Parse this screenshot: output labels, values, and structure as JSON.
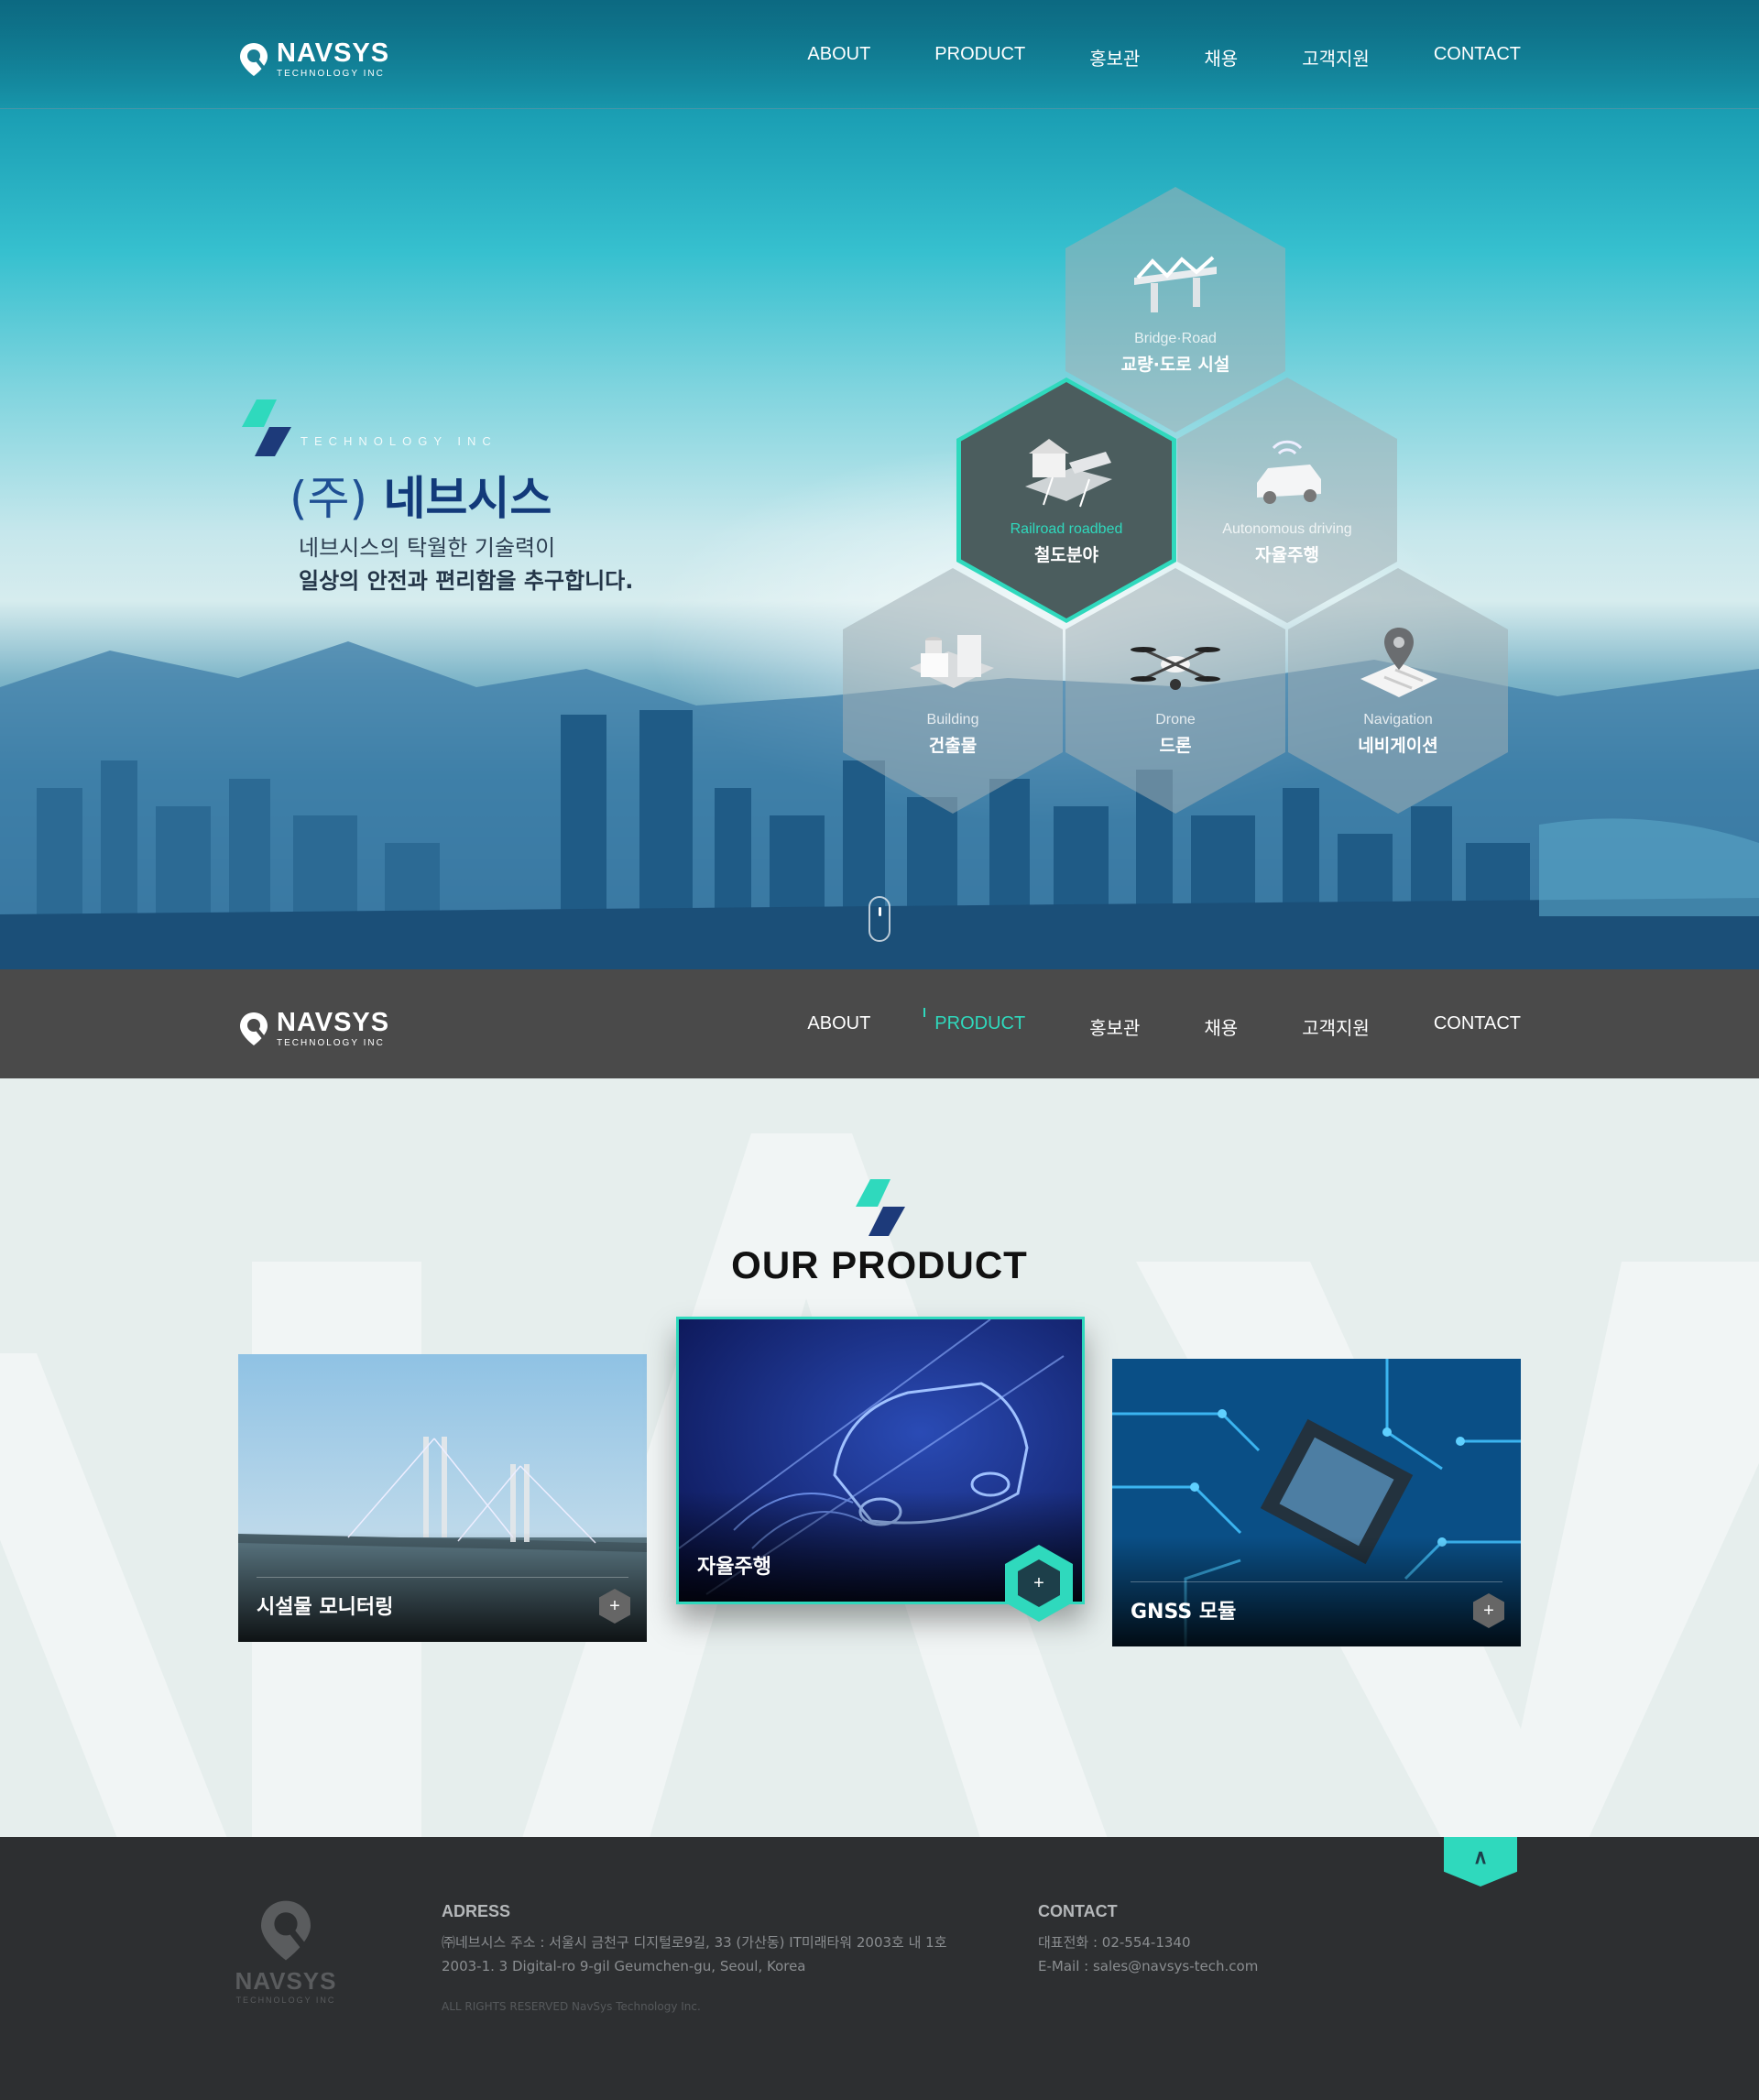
{
  "brand": {
    "name": "NAVSYS",
    "sub": "TECHNOLOGY INC"
  },
  "nav": {
    "items": [
      {
        "label": "ABOUT"
      },
      {
        "label": "PRODUCT"
      },
      {
        "label": "홍보관"
      },
      {
        "label": "채용"
      },
      {
        "label": "고객지원"
      },
      {
        "label": "CONTACT"
      }
    ],
    "active_secondary": "PRODUCT"
  },
  "hero": {
    "tech": "TECHNOLOGY INC",
    "company_paren": "(주)",
    "company_name": "네브시스",
    "line1": "네브시스의 탁월한 기술력이",
    "line2": "일상의 안전과 편리함을 추구합니다.",
    "hexes": [
      {
        "en": "Bridge·Road",
        "ko": "교량·도로 시설",
        "icon": "bridge-icon"
      },
      {
        "en": "Railroad roadbed",
        "ko": "철도분야",
        "icon": "railroad-icon",
        "active": true
      },
      {
        "en": "Autonomous driving",
        "ko": "자율주행",
        "icon": "car-icon"
      },
      {
        "en": "Building",
        "ko": "건출물",
        "icon": "building-icon"
      },
      {
        "en": "Drone",
        "ko": "드론",
        "icon": "drone-icon"
      },
      {
        "en": "Navigation",
        "ko": "네비게이션",
        "icon": "navigation-pin-icon"
      }
    ]
  },
  "products": {
    "heading": "OUR PRODUCT",
    "cards": [
      {
        "title": "시설물 모니터링",
        "plus": "+"
      },
      {
        "title": "자율주행",
        "plus": "+"
      },
      {
        "title": "GNSS 모듈",
        "plus": "+"
      }
    ]
  },
  "footer": {
    "top_icon": "arrow-up-icon",
    "address_heading": "ADRESS",
    "address_line1": "㈜네브시스 주소 : 서울시 금천구 디지털로9길, 33 (가산동) IT미래타워 2003호 내 1호",
    "address_line2": "2003-1. 3 Digital-ro 9-gil Geumchen-gu, Seoul, Korea",
    "contact_heading": "CONTACT",
    "phone": "대표전화 : 02-554-1340",
    "email": "E-Mail : sales@navsys-tech.com",
    "copyright": "ALL RIGHTS RESERVED NavSys Technology Inc."
  },
  "colors": {
    "accent": "#2fd9bd",
    "navy": "#123a7a",
    "dark_bar": "#4a4a4a",
    "footer": "#2d2f31"
  }
}
